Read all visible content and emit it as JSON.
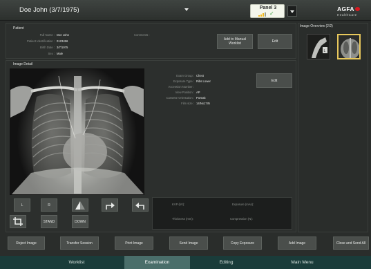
{
  "header": {
    "title": "Doe John (3/7/1975)",
    "panel_label": "Panel 3",
    "logo_text": "AGFA",
    "logo_sub": "HealthCare",
    "logo_icon": "agfa-rhombus-icon",
    "accent_color": "#f1b91c"
  },
  "patient": {
    "section_title": "Patient",
    "fields": [
      {
        "label": "Full Name :",
        "value": "Doe John"
      },
      {
        "label": "Patient Identification :",
        "value": "0123456"
      },
      {
        "label": "Birth Date :",
        "value": "3/7/1975"
      },
      {
        "label": "Sex :",
        "value": "Male"
      }
    ],
    "comments_label": "Comments :",
    "add_manual_worklist": "Add to Manual Worklist",
    "edit_label": "Edit"
  },
  "image_detail": {
    "section_title": "Image Detail",
    "fields": [
      {
        "label": "Exam Group :",
        "value": "Chest"
      },
      {
        "label": "Exposure Type :",
        "value": "Ribs Lower"
      },
      {
        "label": "Accession Number :",
        "value": ""
      },
      {
        "label": "View Position :",
        "value": "AP"
      },
      {
        "label": "Cassette Orientation :",
        "value": "Portrait"
      },
      {
        "label": "Film size :",
        "value": "14INx17IN"
      }
    ],
    "edit_label": "Edit",
    "tools": {
      "left": "L",
      "right": "R",
      "stand": "STAND",
      "down": "DOWN"
    },
    "info": {
      "kvp": "KVP (kV):",
      "exposure": "Exposure (mAs):",
      "thickness": "Thickness (mm):",
      "compression": "Compression (N):"
    }
  },
  "overview": {
    "title": "Image Overview (2/2)"
  },
  "actions": [
    {
      "label": "Reject Image"
    },
    {
      "label": "Transfer Session"
    },
    {
      "label": "Print Image"
    },
    {
      "label": "Send Image"
    },
    {
      "label": "Copy Exposure"
    },
    {
      "label": "Add Image"
    },
    {
      "label": "Close and Send All"
    }
  ],
  "tabs": [
    {
      "label": "Worklist"
    },
    {
      "label": "Examination"
    },
    {
      "label": "Editing"
    },
    {
      "label": "Main Menu"
    }
  ]
}
